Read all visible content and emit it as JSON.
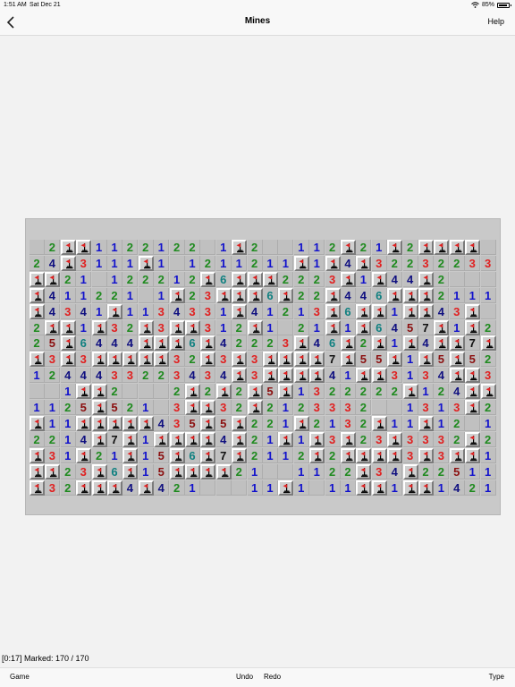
{
  "statusbar": {
    "time": "1:51 AM",
    "date": "Sat Dec 21",
    "battery": "85%",
    "battery_level": 0.85
  },
  "navbar": {
    "title": "Mines",
    "help_label": "Help",
    "back_icon": "chevron-left-icon"
  },
  "status": {
    "text": "[0:17] Marked: 170 / 170"
  },
  "toolbar": {
    "game_label": "Game",
    "undo_label": "Undo",
    "redo_label": "Redo",
    "type_label": "Type"
  },
  "colors": {
    "n1": "#1111cc",
    "n2": "#1e8a1e",
    "n3": "#e02020",
    "n4": "#101080",
    "n5": "#8b1010",
    "n6": "#108080",
    "n7": "#101010",
    "n8": "#808080",
    "flag": "#e02020"
  },
  "board": {
    "cols": 30,
    "rows": 16,
    "legend": "F = flagged mine, . = revealed empty, 1-8 = adjacent mine count",
    "grid": [
      ".2FF1122122.1F2..112F21F2FFFF",
      "24F3111F1.1211211F1F4F322322332",
      "FF21.122212F6FFF2223F1F44F2...",
      "F411221.1F23FFF6F22F446FFF2111",
      "F4341F1134331F41213F6FF1FF43F",
      "2FF1F32F3FF312F1.21F1F6457F1F2",
      "25F6444FFF6F42223F46F2F1F4FF7F41",
      "F3F3FFFFF32F3F3FFFF7F55F1F5F52",
      "1244433223434F3FFFF41FF3134FF3",
      "..1FF2...2F2F2F5F1322222F124FF",
      "1125F521.3FF32F2123332..1313F233",
      "F11FFFFF435F5F221F2132F11F12.121",
      "2214F7F1FFFF4F21F1F3F23F3332F2",
      "F31F21F15F6F7F2112F2FFFF3F3FF1F6F3",
      "FF23F6F15FFFF21..1122F34F22511F2",
      "F32FFF4F421...11F1.11FF1FF1421"
    ]
  }
}
